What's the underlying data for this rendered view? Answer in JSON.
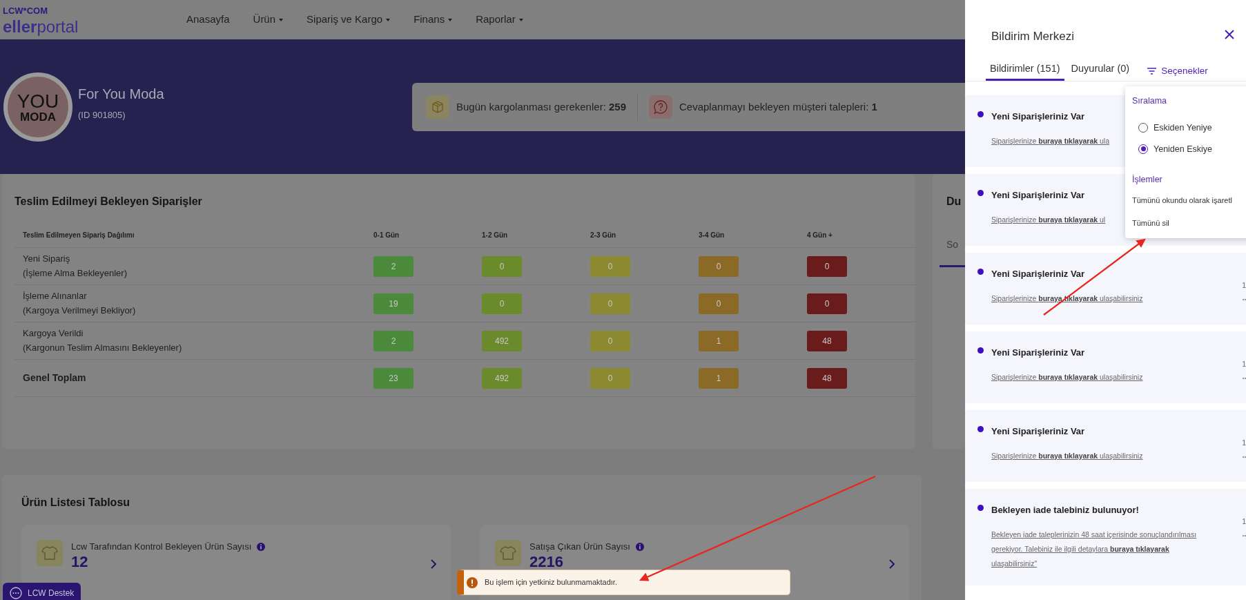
{
  "header": {
    "logo_top": "LCW*COM",
    "logo_text": "**eller**portal",
    "nav": [
      {
        "label": "Anasayfa",
        "dropdown": false
      },
      {
        "label": "Ürün",
        "dropdown": true
      },
      {
        "label": "Sipariş ve Kargo",
        "dropdown": true
      },
      {
        "label": "Finans",
        "dropdown": true
      },
      {
        "label": "Raporlar",
        "dropdown": true
      }
    ]
  },
  "profile": {
    "avatar_text": [
      "YOU",
      "MODA"
    ],
    "name": "For You Moda",
    "id": "(ID 901805)"
  },
  "stats": [
    {
      "kind": "package",
      "text": "Bugün kargolanması gerekenler: **259**"
    },
    {
      "kind": "question",
      "text": "Cevaplanmayı bekleyen müşteri talepleri: **1**"
    }
  ],
  "pending_orders": {
    "title": "Teslim Edilmeyi Bekleyen Siparişler",
    "columns": [
      {
        "label": "Teslim Edilmeyen Sipariş Dağılımı"
      },
      {
        "label": "0-1 Gün",
        "color": "#4a8a3a"
      },
      {
        "label": "1-2 Gün",
        "color": "#6a8a2c"
      },
      {
        "label": "2-3 Gün",
        "color": "#8c8a30"
      },
      {
        "label": "3-4 Gün",
        "color": "#8a6a26"
      },
      {
        "label": "4 Gün +",
        "color": "#6a1c1c"
      }
    ],
    "rows": [
      {
        "kind": "status",
        "label": "Yeni Sipariş",
        "sublabel": "(İşleme Alma Bekleyenler)",
        "values": [
          "2",
          "0",
          "0",
          "0",
          "0"
        ]
      },
      {
        "kind": "status",
        "label": "İşleme Alınanlar",
        "sublabel": "(Kargoya Verilmeyi Bekliyor)",
        "values": [
          "19",
          "0",
          "0",
          "0",
          "0"
        ]
      },
      {
        "kind": "status",
        "label": "Kargoya Verildi",
        "sublabel": "(Kargonun Teslim Almasını Bekleyenler)",
        "values": [
          "2",
          "492",
          "0",
          "1",
          "48"
        ]
      },
      {
        "kind": "total",
        "label": "Genel Toplam",
        "values": [
          "23",
          "492",
          "0",
          "1",
          "48"
        ]
      }
    ]
  },
  "side_card": {
    "title": "Du",
    "tab": "So"
  },
  "product_list": {
    "title": "Ürün Listesi Tablosu",
    "tiles": [
      {
        "label": "Lcw Tarafından Kontrol Bekleyen Ürün Sayısı",
        "value": "12"
      },
      {
        "label": "Satışa Çıkan Ürün Sayısı",
        "value": "2216"
      }
    ]
  },
  "notification_center": {
    "title": "Bildirim Merkezi",
    "tabs": [
      {
        "label": "Bildirimler (151)",
        "selected": true
      },
      {
        "label": "Duyurular (0)",
        "selected": false
      }
    ],
    "options_button": "Seçenekler",
    "items": [
      {
        "title": "Yeni Siparişleriniz Var",
        "body": "Siparişlerinize **buraya tıklayarak** ula",
        "unread": true
      },
      {
        "title": "Yeni Siparişleriniz Var",
        "body": "Siparişlerinize **buraya tıklayarak** ul",
        "unread": true
      },
      {
        "title": "Yeni Siparişleriniz Var",
        "body": "Siparişlerinize **buraya tıklayarak** ulaşabilirsiniz",
        "time": "1",
        "unread": true
      },
      {
        "title": "Yeni Siparişleriniz Var",
        "body": "Siparişlerinize **buraya tıklayarak** ulaşabilirsiniz",
        "time": "1",
        "unread": true
      },
      {
        "title": "Yeni Siparişleriniz Var",
        "body": "Siparişlerinize **buraya tıklayarak** ulaşabilirsiniz",
        "time": "1",
        "unread": true
      },
      {
        "title": "Bekleyen iade talebiniz bulunuyor!",
        "body": "Bekleyen iade taleplerinizin 48 saat içerisinde sonuçlandırılması gerekiyor. Talebiniz ile ilgili detaylara **buraya tıklayarak** ulaşabilirsiniz\"",
        "time": "1",
        "unread": true
      }
    ],
    "options_menu": [
      {
        "title": "Sıralama",
        "kind": "radio",
        "options": [
          {
            "label": "Eskiden Yeniye",
            "selected": false
          },
          {
            "label": "Yeniden Eskiye",
            "selected": true
          }
        ]
      },
      {
        "title": "İşlemler",
        "kind": "actions",
        "options": [
          {
            "label": "Tümünü okundu olarak işaretl"
          },
          {
            "label": "Tümünü sil"
          }
        ]
      }
    ]
  },
  "toast": {
    "kind": "warning",
    "message": "Bu işlem için yetkiniz bulunmamaktadır."
  },
  "support_button": "LCW Destek"
}
